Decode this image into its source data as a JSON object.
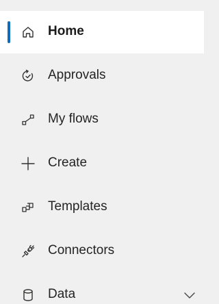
{
  "nav": {
    "items": [
      {
        "label": "Home",
        "icon": "home-icon",
        "selected": true
      },
      {
        "label": "Approvals",
        "icon": "approvals-icon",
        "selected": false
      },
      {
        "label": "My flows",
        "icon": "flow-icon",
        "selected": false
      },
      {
        "label": "Create",
        "icon": "plus-icon",
        "selected": false
      },
      {
        "label": "Templates",
        "icon": "templates-icon",
        "selected": false
      },
      {
        "label": "Connectors",
        "icon": "connectors-icon",
        "selected": false
      },
      {
        "label": "Data",
        "icon": "database-icon",
        "selected": false,
        "expandable": true,
        "expand_icon": "chevron-down-icon"
      }
    ]
  },
  "colors": {
    "background": "#f0f0f0",
    "selected_background": "#ffffff",
    "accent": "#0f6cbd",
    "text": "#242424"
  }
}
